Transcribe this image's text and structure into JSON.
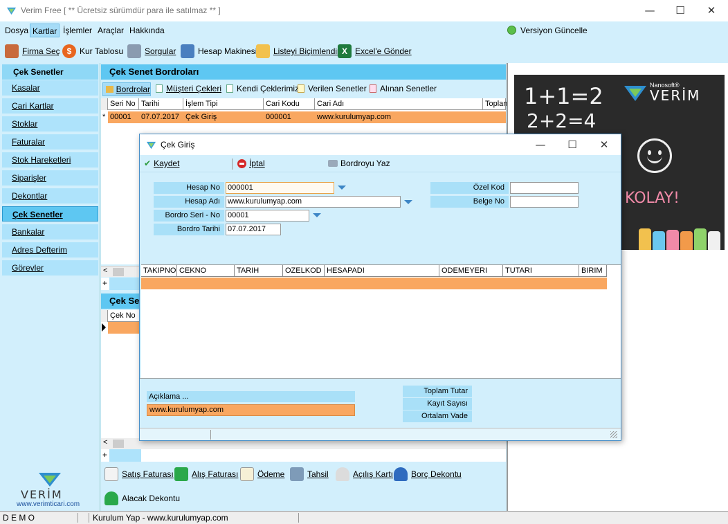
{
  "window": {
    "title": "Verim Free  [  ** Ücretsiz sürümdür para ile satılmaz **  ]",
    "controls": {
      "minimize": "—",
      "maximize": "☐",
      "close": "✕"
    }
  },
  "menu": {
    "items": [
      "Dosya",
      "Kartlar",
      "İşlemler",
      "Araçlar",
      "Hakkında"
    ],
    "version_label": "Versiyon Güncelle"
  },
  "toolbar": {
    "items": [
      "Firma Seç",
      "Kur Tablosu",
      "Sorgular",
      "Hesap Makinesi",
      "Listeyi Biçimlendir",
      "Excel'e Gönder"
    ]
  },
  "sidebar": {
    "header": "Çek Senetler",
    "items": [
      "Kasalar",
      "Cari Kartlar",
      "Stoklar",
      "Faturalar",
      "Stok Hareketleri",
      "Siparişler",
      "Dekontlar",
      "Çek Senetler",
      "Bankalar",
      "Adres Defterim",
      "Görevler"
    ],
    "brand": "VERİM",
    "brand_url": "www.verimticari.com"
  },
  "main": {
    "panel_title": "Çek Senet Bordroları",
    "tabs": [
      "Bordrolar",
      "Müşteri Çekleri",
      "Kendi Çeklerimiz",
      "Verilen Senetler",
      "Alınan Senetler"
    ],
    "columns": [
      "Seri No",
      "Tarihi",
      "İşlem Tipi",
      "Cari Kodu",
      "Cari Adı",
      "Toplam"
    ],
    "row": {
      "marker": "*",
      "seri_no": "00001",
      "tarihi": "07.07.2017",
      "islem_tipi": "Çek Giriş",
      "cari_kodu": "000001",
      "cari_adi": "www.kurulumyap.com"
    },
    "second_panel_title": "Çek Se",
    "second_columns": [
      "Çek No"
    ],
    "bottom_buttons": [
      "Satış Faturası",
      "Alış Faturası",
      "Ödeme",
      "Tahsil",
      "Açılış Kartı",
      "Borç Dekontu",
      "Alacak Dekontu"
    ]
  },
  "promo": {
    "brand_small": "Nanosoft®",
    "brand": "VERİM",
    "line1": "1+1=2",
    "line2": "2+2=4",
    "kolay": "KOLAY!"
  },
  "status": {
    "mode": "D E M O",
    "company": "Kurulum Yap - www.kurulumyap.com"
  },
  "dialog": {
    "title": "Çek Giriş",
    "actions": {
      "save": "Kaydet",
      "cancel": "İptal",
      "print": "Bordroyu Yaz"
    },
    "fields": {
      "hesap_no_label": "Hesap No",
      "hesap_no": "000001",
      "hesap_adi_label": "Hesap Adı",
      "hesap_adi": "www.kurulumyap.com",
      "bordro_seri_label": "Bordro Seri - No",
      "bordro_seri": "00001",
      "bordro_tarihi_label": "Bordro Tarihi",
      "bordro_tarihi": "07.07.2017",
      "ozel_kod_label": "Özel Kod",
      "ozel_kod": "",
      "belge_no_label": "Belge No",
      "belge_no": ""
    },
    "grid_columns": [
      "TAKIPNO",
      "CEKNO",
      "TARIH",
      "OZELKOD",
      "HESAPADI",
      "ODEMEYERI",
      "TUTARI",
      "BIRIM"
    ],
    "aciklama_label": "Açıklama ...",
    "aciklama_value": "www.kurulumyap.com",
    "summary": [
      "Toplam Tutar",
      "Kayıt Sayısı",
      "Ortalam Vade"
    ]
  },
  "colors": {
    "accent": "#5ec7f2",
    "panel": "#d2effc",
    "row_highlight": "#f9a760"
  }
}
